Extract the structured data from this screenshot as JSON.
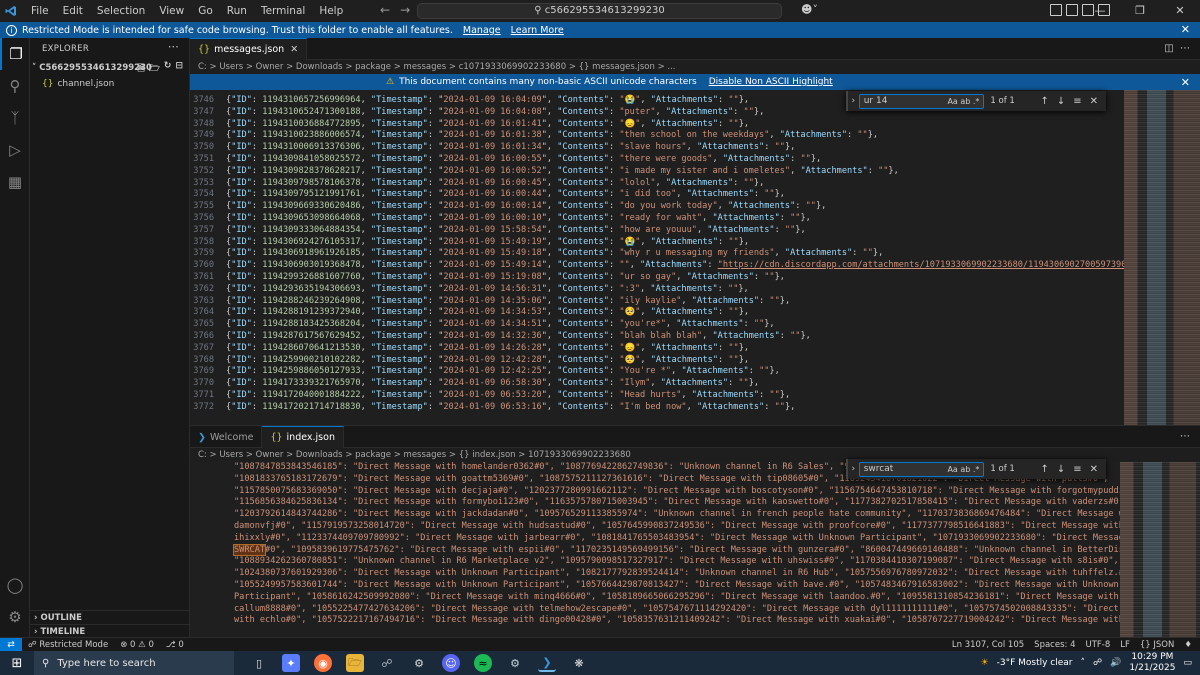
{
  "titlebar": {
    "menu": [
      "File",
      "Edit",
      "Selection",
      "View",
      "Go",
      "Run",
      "Terminal",
      "Help"
    ],
    "command_center": "c566295534613299230"
  },
  "banner": {
    "text": "Restricted Mode is intended for safe code browsing. Trust this folder to enable all features.",
    "manage": "Manage",
    "learn_more": "Learn More"
  },
  "sidebar": {
    "header": "EXPLORER",
    "folder": "C566295534613299230",
    "files": [
      "channel.json"
    ],
    "outline": "OUTLINE",
    "timeline": "TIMELINE"
  },
  "top_editor": {
    "tab": "messages.json",
    "breadcrumb": "C: > Users > Owner > Downloads > package > messages > c1071933069902233680 > {} messages.json > ...",
    "warning": "This document contains many non-basic ASCII unicode characters",
    "warning_action": "Disable Non ASCII Highlight",
    "find": {
      "value": "ur 14",
      "count": "1 of 1",
      "opts": "Aa ab .*"
    },
    "lines": [
      {
        "n": "3746",
        "id": "1194310657256996964",
        "ts": "2024-01-09 16:04:09",
        "c": "\"😭\"",
        "a": "\"\""
      },
      {
        "n": "3747",
        "id": "1194310652471300188",
        "ts": "2024-01-09 16:04:08",
        "c": "\"puter\"",
        "a": "\"\""
      },
      {
        "n": "3748",
        "id": "1194310036884772895",
        "ts": "2024-01-09 16:01:41",
        "c": "\"😞\"",
        "a": "\"\""
      },
      {
        "n": "3749",
        "id": "1194310023886006574",
        "ts": "2024-01-09 16:01:38",
        "c": "\"then school on the weekdays\"",
        "a": "\"\""
      },
      {
        "n": "3750",
        "id": "1194310006913376306",
        "ts": "2024-01-09 16:01:34",
        "c": "\"slave hours\"",
        "a": "\"\""
      },
      {
        "n": "3751",
        "id": "1194309841058025572",
        "ts": "2024-01-09 16:00:55",
        "c": "\"there were goods\"",
        "a": "\"\""
      },
      {
        "n": "3752",
        "id": "1194309828378628217",
        "ts": "2024-01-09 16:00:52",
        "c": "\"i made my sister and i omeletes\"",
        "a": "\"\""
      },
      {
        "n": "3753",
        "id": "1194309798578106378",
        "ts": "2024-01-09 16:00:45",
        "c": "\"lolol\"",
        "a": "\"\""
      },
      {
        "n": "3754",
        "id": "1194309795121991761",
        "ts": "2024-01-09 16:00:44",
        "c": "\"i did too\"",
        "a": "\"\""
      },
      {
        "n": "3755",
        "id": "1194309669330620486",
        "ts": "2024-01-09 16:00:14",
        "c": "\"do you work today\"",
        "a": "\"\""
      },
      {
        "n": "3756",
        "id": "1194309653098664068",
        "ts": "2024-01-09 16:00:10",
        "c": "\"ready for waht\"",
        "a": "\"\""
      },
      {
        "n": "3757",
        "id": "1194309333064884354",
        "ts": "2024-01-09 15:58:54",
        "c": "\"how are youuu\"",
        "a": "\"\""
      },
      {
        "n": "3758",
        "id": "1194306924276105317",
        "ts": "2024-01-09 15:49:19",
        "c": "\"😭\"",
        "a": "\"\""
      },
      {
        "n": "3759",
        "id": "1194306918961926185",
        "ts": "2024-01-09 15:49:18",
        "c": "\"why r u messaging my friends\"",
        "a": "\"\""
      },
      {
        "n": "3760",
        "id": "1194306903019368478",
        "ts": "2024-01-09 15:49:14",
        "c": "\"\"",
        "a": "\"https://cdn.discordapp.com/attachments/1071933069902233680/1194306902700597390/image.pr"
      },
      {
        "n": "3761",
        "id": "1194299326881607760",
        "ts": "2024-01-09 15:19:08",
        "c": "\"ur so gay\"",
        "a": "\"\""
      },
      {
        "n": "3762",
        "id": "1194293635194306693",
        "ts": "2024-01-09 14:56:31",
        "c": "\":3\"",
        "a": "\"\""
      },
      {
        "n": "3763",
        "id": "1194288246239264908",
        "ts": "2024-01-09 14:35:06",
        "c": "\"ily kaylie\"",
        "a": "\"\""
      },
      {
        "n": "3764",
        "id": "1194288191239372940",
        "ts": "2024-01-09 14:34:53",
        "c": "\"🥺\"",
        "a": "\"\""
      },
      {
        "n": "3765",
        "id": "1194288183425368204",
        "ts": "2024-01-09 14:34:51",
        "c": "\"you're*\"",
        "a": "\"\""
      },
      {
        "n": "3766",
        "id": "1194287617567629452",
        "ts": "2024-01-09 14:32:36",
        "c": "\"blah blah blah\"",
        "a": "\"\""
      },
      {
        "n": "3767",
        "id": "1194286070641213530",
        "ts": "2024-01-09 14:26:28",
        "c": "\"😞\"",
        "a": "\"\""
      },
      {
        "n": "3768",
        "id": "1194259900210102282",
        "ts": "2024-01-09 12:42:28",
        "c": "\"🥺\"",
        "a": "\"\""
      },
      {
        "n": "3769",
        "id": "1194259886050127933",
        "ts": "2024-01-09 12:42:25",
        "c": "\"You're *\"",
        "a": "\"\""
      },
      {
        "n": "3770",
        "id": "1194173339321765970",
        "ts": "2024-01-09 06:58:30",
        "c": "\"Ilym\"",
        "a": "\"\""
      },
      {
        "n": "3771",
        "id": "1194172040001884222",
        "ts": "2024-01-09 06:53:20",
        "c": "\"Head hurts\"",
        "a": "\"\""
      },
      {
        "n": "3772",
        "id": "1194172021714718830",
        "ts": "2024-01-09 06:53:16",
        "c": "\"I'm bed now\"",
        "a": "\"\""
      }
    ]
  },
  "bottom_editor": {
    "tabs": [
      "Welcome",
      "index.json"
    ],
    "breadcrumb": "C: > Users > Owner > Downloads > package > messages > {} index.json > 1071933069902233680",
    "find": {
      "value": "swrcat",
      "count": "1 of 1",
      "opts": "Aa ab .*"
    },
    "lines": [
      [
        "\"1087847853843546185\": \"Direct Message with homelander0362#0\", \"1087769422862749836\": \"Unknown channel in R6 Sales\", \"98740979"
      ],
      [
        "\"1081833765183172679\": \"Direct Message with goattm5369#0\", \"1087575211127361616\": \"Direct Message with tip08605#0\", \"1169245416701821022\": \"Direct Message with pulls#0\","
      ],
      [
        "\"1157850075683369050\": \"Direct Message with decjaja#0\", \"1202377280991662112\": \"Direct Message with boscotyson#0\", \"1156754647453810718\": \"Direct Message with forgotmypuddin#0\","
      ],
      [
        "\"1156856384625836134\": \"Direct Message with formyboi123#0\", \"1163575780715003945\": \"Direct Message with kaoswetto#0\", \"1177382702517858415\": \"Direct Message with vaderzs#0\","
      ],
      [
        "\"1203792614843744286\": \"Direct Message with jackdadan#0\", \"1095765291133855974\": \"Unknown channel in french people hate community\", \"1170373836869476484\": \"Direct Message with"
      ],
      [
        "damonvfj#0\", \"1157919573258014720\": \"Direct Message with hudsastud#0\", \"1057645990837249536\": \"Direct Message with proofcore#0\", \"1177377798516641883\": \"Direct Message with"
      ],
      [
        "ihixxly#0\", \"1123374409709780992\": \"Direct Message with jarbearr#0\", \"1081841765503483954\": \"Direct Message with Unknown Participant\", \"1071933069902233680\": \"Direct Message with"
      ],
      [
        "SWRCAT",
        "#0\", \"1095839619775475762\": \"Direct Message with espii#0\", \"1170235149569499156\": \"Direct Message with gunzera#0\", \"860047449669140488\": \"Unknown channel in BetterDiscord\","
      ],
      [
        "\"1088934262360780851\": \"Unknown channel in R6 Marketplace v2\", \"1095790098517327917\": \"Direct Message with uhswiss#0\", \"1170384410307199087\": \"Direct Message with s8is#0\","
      ],
      [
        "\"1024380737601929306\": \"Direct Message with Unknown Participant\", \"1082177792839524414\": \"Unknown channel in R6 Hub\", \"1057556976780972032\": \"Direct Message with tuhffelz.#0\","
      ],
      [
        "\"1055249957583601744\": \"Direct Message with Unknown Participant\", \"1057664429870813427\": \"Direct Message with bave.#0\", \"1057483467916583002\": \"Direct Message with Unknown"
      ],
      [
        "Participant\", \"1058616242509992080\": \"Direct Message with minq4666#0\", \"1058189665066295296\": \"Direct Message with laandoo.#0\", \"1095581310854236181\": \"Direct Message with"
      ],
      [
        "callum8888#0\", \"1055225477427634206\": \"Direct Message with telmehow2escape#0\", \"1057547671114292420\": \"Direct Message with dyl1111111111#0\", \"1057574502008843335\": \"Direct Message"
      ],
      [
        "with echlo#0\", \"1057522217167494716\": \"Direct Message with dingo00428#0\", \"1058357631211409242\": \"Direct Message with xuakai#0\", \"1058767227719004242\": \"Direct Message with"
      ]
    ]
  },
  "statusbar": {
    "restricted": "Restricted Mode",
    "errors": "⊗ 0 ⚠ 0",
    "ports": "⎇ 0",
    "position": "Ln 3107, Col 105",
    "spaces": "Spaces: 4",
    "encoding": "UTF-8",
    "eol": "LF",
    "language": "{} JSON"
  },
  "taskbar": {
    "search_placeholder": "Type here to search",
    "weather": "-3°F  Mostly clear",
    "time": "10:29 PM",
    "date": "1/21/2025"
  },
  "colors": {
    "accent": "#0078d4",
    "banner": "#0e5899",
    "string": "#ce9178",
    "key": "#9cdcfe",
    "number": "#b5cea8"
  }
}
